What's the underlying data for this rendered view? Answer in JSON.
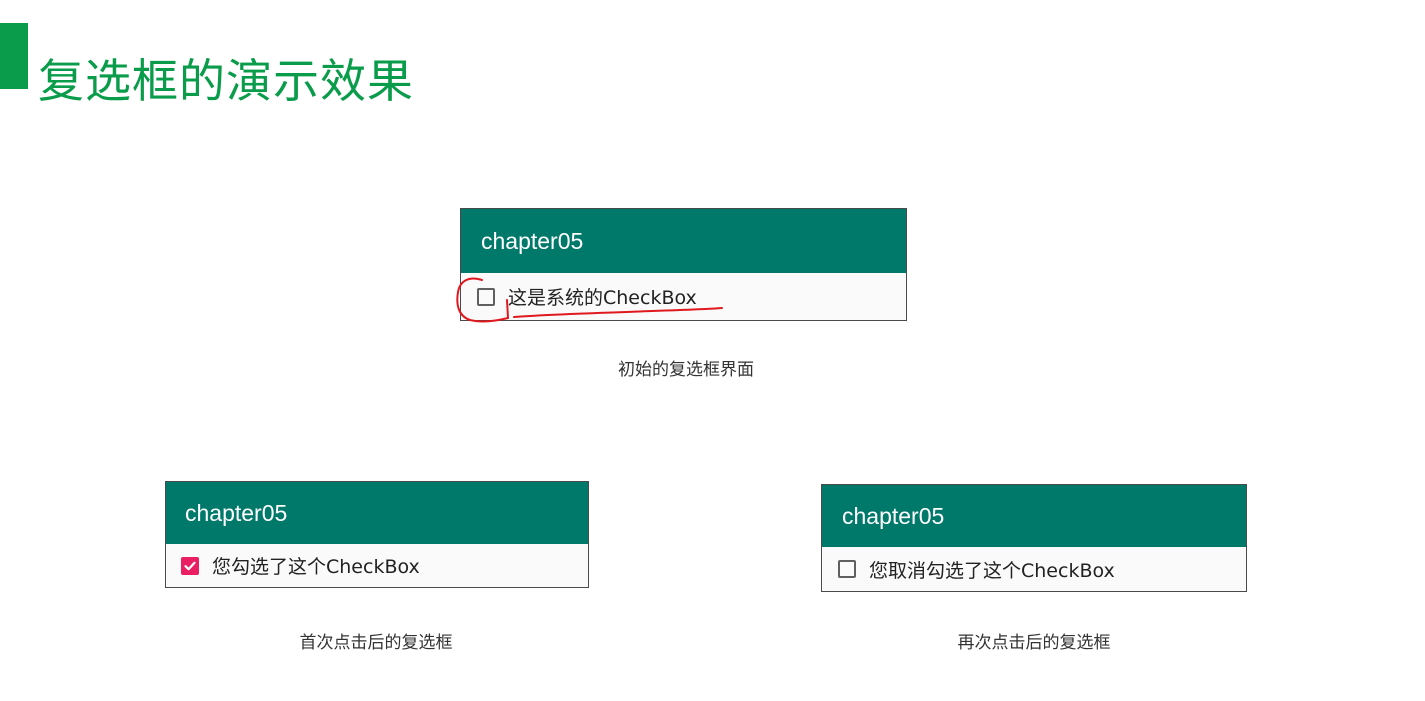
{
  "slide": {
    "title": "复选框的演示效果",
    "accent_color": "#0a9c4a"
  },
  "screens": {
    "initial": {
      "app_title": "chapter05",
      "checkbox_label": "这是系统的CheckBox",
      "checked": false,
      "caption": "初始的复选框界面"
    },
    "checked": {
      "app_title": "chapter05",
      "checkbox_label": "您勾选了这个CheckBox",
      "checked": true,
      "caption": "首次点击后的复选框"
    },
    "unchecked": {
      "app_title": "chapter05",
      "checkbox_label": "您取消勾选了这个CheckBox",
      "checked": false,
      "caption": "再次点击后的复选框"
    }
  },
  "colors": {
    "appbar": "#00796b",
    "checkbox_checked": "#e91e63",
    "annotation": "#e0191f"
  },
  "icons": {
    "checkbox_unchecked": "checkbox-unchecked-icon",
    "checkbox_checked": "checkbox-checked-icon"
  }
}
